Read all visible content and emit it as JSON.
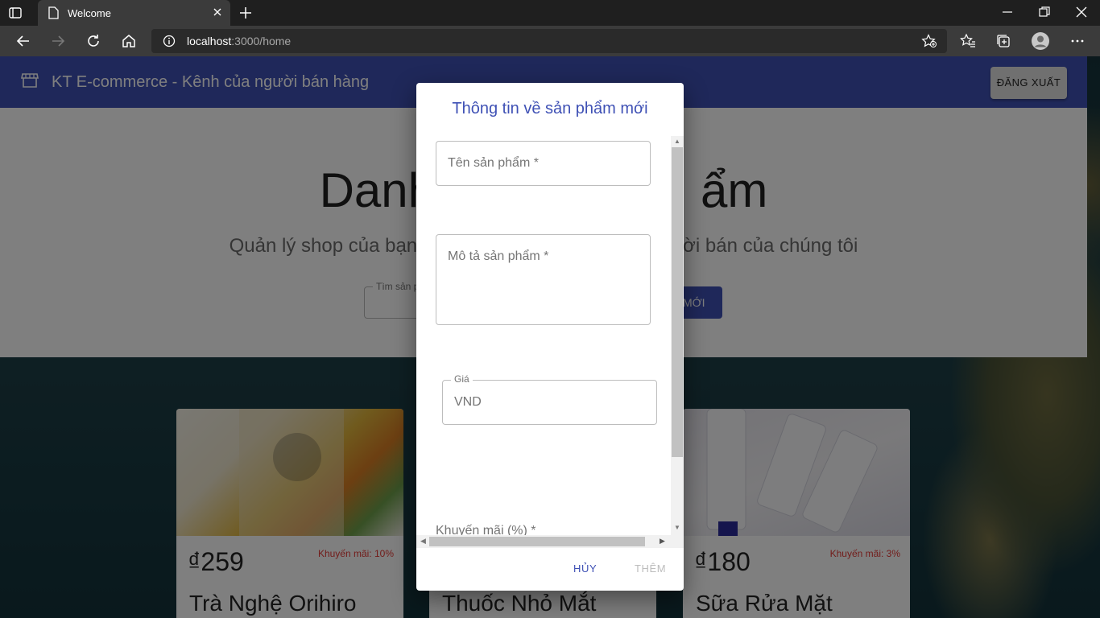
{
  "browser": {
    "tab_title": "Welcome",
    "url_host": "localhost",
    "url_rest": ":3000/home"
  },
  "appbar": {
    "brand": "KT E-commerce - Kênh của người bán hàng",
    "logout_label": "ĐĂNG XUẤT"
  },
  "hero": {
    "heading_left": "Danh",
    "heading_right": "ẩm",
    "subtitle_left": "Quản lý shop của bạn",
    "subtitle_right": "ời bán của chúng tôi",
    "search_label": "Tìm sản p",
    "add_button_fragment": "MỚI"
  },
  "products": [
    {
      "price": "₫259",
      "promo": "Khuyến mãi: 10%",
      "name": "Trà Nghệ Orihiro"
    },
    {
      "price": "",
      "promo": "",
      "name": "Thuốc Nhỏ Mắt"
    },
    {
      "price": "₫180",
      "promo": "Khuyến mãi: 3%",
      "name": "Sữa Rửa Mặt"
    }
  ],
  "dialog": {
    "title": "Thông tin về sản phẩm mới",
    "name_placeholder": "Tên sản phẩm *",
    "desc_placeholder": "Mô tả sản phẩm *",
    "price_label": "Giá",
    "price_placeholder": "VND",
    "discount_placeholder": "Khuyến mãi (%) *",
    "cancel_label": "HỦY",
    "submit_label": "THÊM"
  },
  "colors": {
    "primary": "#3f51b5",
    "promo": "#e53935"
  }
}
